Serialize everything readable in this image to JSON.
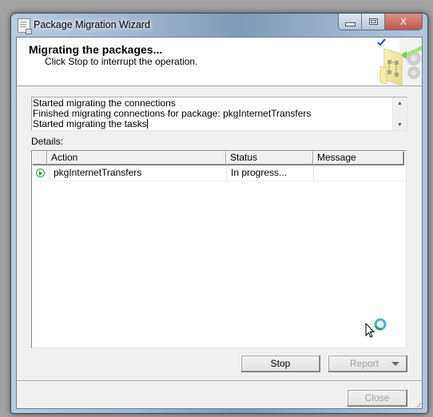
{
  "window": {
    "title": "Package Migration Wizard",
    "icon": "document-icon",
    "controls": {
      "minimize": "minimize-icon",
      "maximize": "maximize-icon",
      "close": "X"
    }
  },
  "header": {
    "title": "Migrating the packages...",
    "subtitle": "Click Stop to interrupt the operation.",
    "art_icon": "wizard-package-gear-icon"
  },
  "log": {
    "lines": [
      "Started migrating the connections",
      "Finished migrating connections for package: pkgInternetTransfers",
      "Started migrating the tasks"
    ]
  },
  "details": {
    "label": "Details:",
    "columns": [
      "Action",
      "Status",
      "Message"
    ],
    "rows": [
      {
        "icon": "running-play-icon",
        "action": "pkgInternetTransfers",
        "status": "In progress...",
        "message": ""
      }
    ]
  },
  "buttons": {
    "stop": "Stop",
    "report": "Report",
    "close": "Close"
  },
  "colors": {
    "running_icon": "#1f9a3a",
    "close_button": "#c0574b",
    "checkmark": "#2a56b8"
  }
}
